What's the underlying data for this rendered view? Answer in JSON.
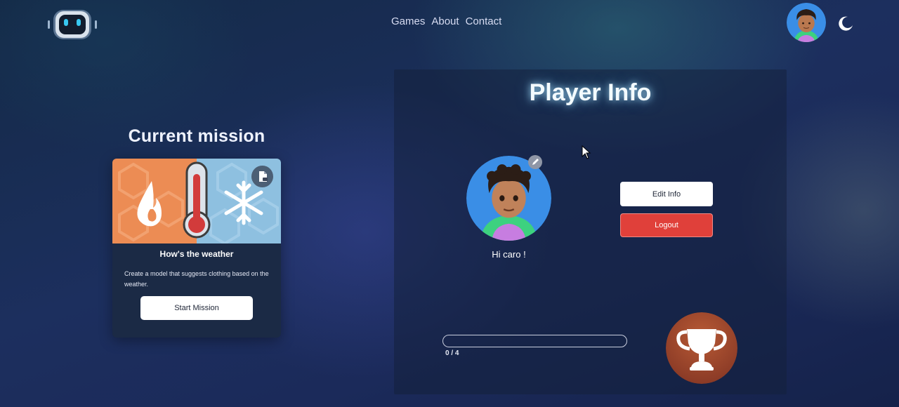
{
  "nav": {
    "links": [
      "Games",
      "About",
      "Contact"
    ]
  },
  "icons": {
    "logo": "robot-logo-icon",
    "theme": "moon-icon",
    "document": "document-icon",
    "edit": "pencil-icon",
    "trophy": "trophy-icon",
    "cursor": "mouse-cursor-icon"
  },
  "mission": {
    "heading": "Current mission",
    "title": "How's the weather",
    "description": "Create a model that suggests clothing based on the weather.",
    "start_label": "Start Mission"
  },
  "player": {
    "heading": "Player Info",
    "greeting": "Hi caro !",
    "edit_label": "Edit Info",
    "logout_label": "Logout",
    "progress_text": "0 / 4",
    "progress_fraction": 0
  },
  "colors": {
    "logout": "#e0403a",
    "trophy_bg": "#a04a2e",
    "heading_glow": "#aee6ff",
    "mission_orange": "#ec8c54",
    "mission_blue": "#8ec0e0"
  }
}
